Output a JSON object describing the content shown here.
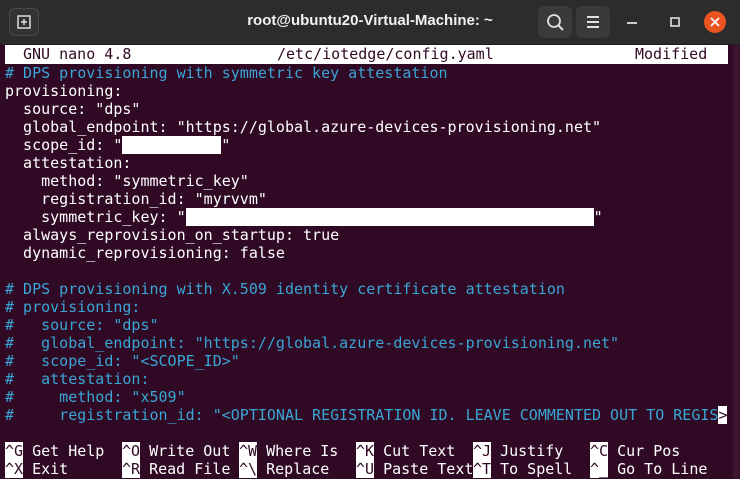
{
  "window": {
    "title": "root@ubuntu20-Virtual-Machine: ~",
    "new_tab_icon": "new-tab-icon",
    "search_icon": "search-icon",
    "menu_icon": "hamburger-menu-icon",
    "minimize_icon": "minimize-icon",
    "maximize_icon": "maximize-icon",
    "close_icon": "close-icon",
    "close_color": "#e95420"
  },
  "nano": {
    "version": "GNU nano 4.8",
    "filename": "/etc/iotedge/config.yaml",
    "status": "Modified"
  },
  "content": {
    "l1": "# DPS provisioning with symmetric key attestation",
    "l2": "provisioning:",
    "l3": "  source: \"dps\"",
    "l4": "  global_endpoint: \"https://global.azure-devices-provisioning.net\"",
    "l5a": "  scope_id: \"",
    "l5b": "\"",
    "l6": "  attestation:",
    "l7": "    method: \"symmetric_key\"",
    "l8": "    registration_id: \"myrvvm\"",
    "l9a": "    symmetric_key: \"",
    "l9b": "\"",
    "l10": "  always_reprovision_on_startup: true",
    "l11": "  dynamic_reprovisioning: false",
    "l12": "# DPS provisioning with X.509 identity certificate attestation",
    "l13": "# provisioning:",
    "l14": "#   source: \"dps\"",
    "l15": "#   global_endpoint: \"https://global.azure-devices-provisioning.net\"",
    "l16": "#   scope_id: \"<SCOPE_ID>\"",
    "l17": "#   attestation:",
    "l18": "#     method: \"x509\"",
    "l19a": "#     registration_id: \"<OPTIONAL REGISTRATION ID. LEAVE COMMENTED OUT TO REGIS",
    "l19b": ">"
  },
  "shortcuts": [
    {
      "key": "^G",
      "label": "Get Help"
    },
    {
      "key": "^O",
      "label": "Write Out"
    },
    {
      "key": "^W",
      "label": "Where Is"
    },
    {
      "key": "^K",
      "label": "Cut Text"
    },
    {
      "key": "^J",
      "label": "Justify"
    },
    {
      "key": "^C",
      "label": "Cur Pos"
    },
    {
      "key": "^X",
      "label": "Exit"
    },
    {
      "key": "^R",
      "label": "Read File"
    },
    {
      "key": "^\\",
      "label": "Replace"
    },
    {
      "key": "^U",
      "label": "Paste Text"
    },
    {
      "key": "^T",
      "label": "To Spell"
    },
    {
      "key": "^_",
      "label": "Go To Line"
    }
  ]
}
